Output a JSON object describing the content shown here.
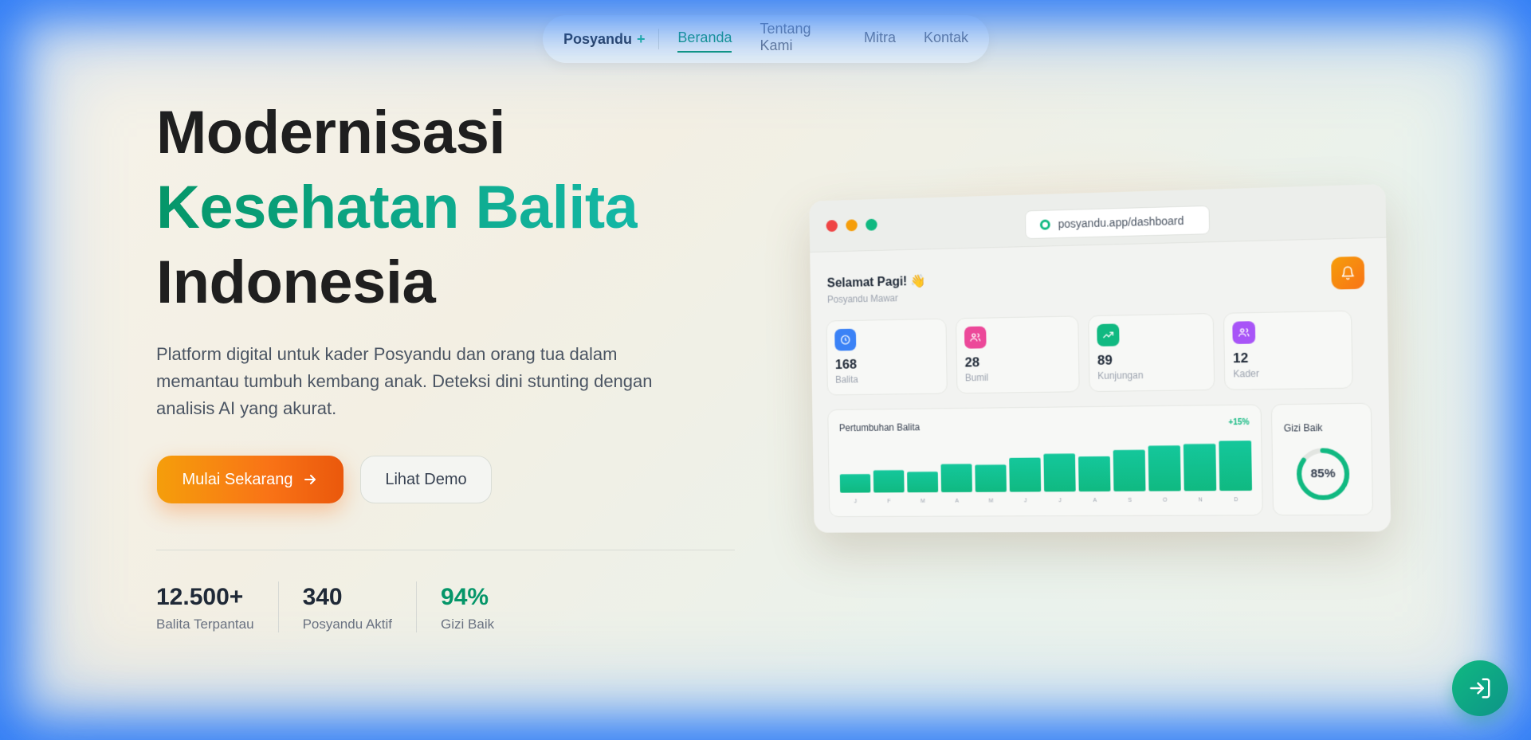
{
  "nav": {
    "brand": "Posyandu",
    "brand_plus": "+",
    "links": [
      "Beranda",
      "Tentang Kami",
      "Mitra",
      "Kontak"
    ],
    "active_index": 0
  },
  "hero": {
    "title_line1": "Modernisasi",
    "title_line2": "Kesehatan Balita",
    "title_line3": "Indonesia",
    "description": "Platform digital untuk kader Posyandu dan orang tua dalam memantau tumbuh kembang anak. Deteksi dini stunting dengan analisis AI yang akurat.",
    "primary_button": "Mulai Sekarang",
    "secondary_button": "Lihat Demo"
  },
  "stats": [
    {
      "value": "12.500+",
      "label": "Balita Terpantau"
    },
    {
      "value": "340",
      "label": "Posyandu Aktif"
    },
    {
      "value": "94%",
      "label": "Gizi Baik"
    }
  ],
  "dashboard": {
    "url": "posyandu.app/dashboard",
    "greeting": "Selamat Pagi! 👋",
    "subtitle": "Posyandu Mawar",
    "cards": [
      {
        "value": "168",
        "label": "Balita",
        "icon": "baby-icon",
        "color": "#3b82f6"
      },
      {
        "value": "28",
        "label": "Bumil",
        "icon": "users-icon",
        "color": "#ec4899"
      },
      {
        "value": "89",
        "label": "Kunjungan",
        "icon": "trending-up-icon",
        "color": "#10b981"
      },
      {
        "value": "12",
        "label": "Kader",
        "icon": "users-icon",
        "color": "#a855f7"
      }
    ],
    "gizi_label": "Gizi Baik",
    "gizi_percent_text": "85%"
  },
  "chart_data": {
    "type": "bar",
    "title": "Pertumbuhan Balita",
    "badge": "+15%",
    "categories": [
      "J",
      "F",
      "M",
      "A",
      "M",
      "J",
      "J",
      "A",
      "S",
      "O",
      "N",
      "D"
    ],
    "values": [
      40,
      48,
      44,
      60,
      58,
      72,
      80,
      74,
      87,
      95,
      98,
      104
    ]
  },
  "gauge": {
    "value": 0.85
  },
  "colors": {
    "accent_green": "#10b981",
    "accent_orange": "#f97316",
    "frame_blue": "#2f7cf6"
  }
}
